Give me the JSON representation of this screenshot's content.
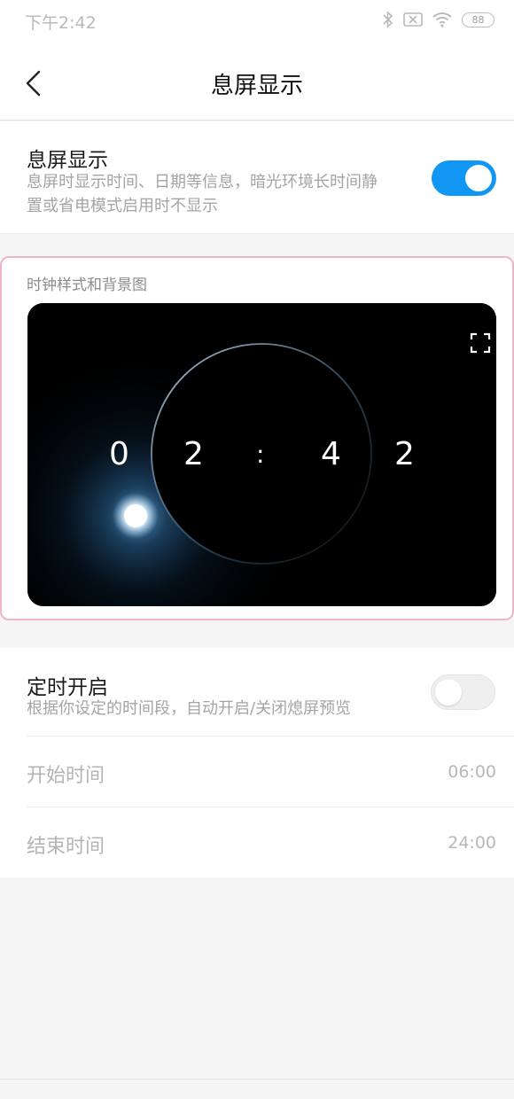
{
  "status_bar": {
    "time": "下午2:42",
    "icons": [
      "bluetooth-icon",
      "sim-off-icon",
      "wifi-icon",
      "battery-icon"
    ],
    "battery": "88"
  },
  "header": {
    "back_icon": "chevron-left-icon",
    "title": "息屏显示"
  },
  "aod_setting": {
    "title": "息屏显示",
    "description_line1": "息屏时显示时间、日期等信息，暗光环境长时间静",
    "description_line2": "置或省电模式启用时不显示",
    "enabled": true
  },
  "clock_style": {
    "label": "时钟样式和背景图",
    "digits": [
      "0",
      "2",
      ":",
      "4",
      "2"
    ],
    "expand_icon": "fullscreen-icon"
  },
  "schedule": {
    "title": "定时开启",
    "description": "根据你设定的时间段，自动开启/关闭熄屏预览",
    "enabled": false,
    "start_label": "开始时间",
    "start_value": "06:00",
    "end_label": "结束时间",
    "end_value": "24:00"
  },
  "colors": {
    "accent": "#1296f3",
    "highlight_border": "#f2b4c8",
    "background": "#f5f5f5"
  }
}
